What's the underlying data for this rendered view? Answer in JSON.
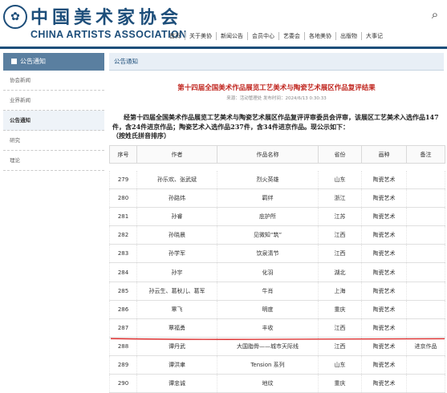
{
  "header": {
    "logo_cn": "中国美术家协会",
    "logo_en": "CHINA ARTISTS ASSOCIATION",
    "nav": [
      "首页",
      "关于美协",
      "新闻公告",
      "会员中心",
      "艺委会",
      "各地美协",
      "出版物",
      "大事记"
    ]
  },
  "sidebar": {
    "title": "公告通知",
    "items": [
      "协会新闻",
      "业界新闻",
      "公告通知",
      "研究",
      "理论"
    ],
    "active_index": 2
  },
  "breadcrumb": "公告通知",
  "article": {
    "title": "第十四届全国美术作品展览工艺美术与陶瓷艺术展区作品复评结果",
    "meta": "来源：活动管理处  发布时间：2024/6/13 0:30:33",
    "paragraph": "经第十四届全国美术作品展览工艺美术与陶瓷艺术展区作品复评评审委员会评审，该展区工艺美术入选作品147件，含24件进京作品；陶瓷艺术入选作品237件，含34件进京作品。现公示如下：",
    "note": "（按姓氏拼音排序）"
  },
  "table": {
    "columns": [
      "序号",
      "作者",
      "作品名称",
      "省份",
      "画种",
      "备注"
    ],
    "rows": [
      [
        "279",
        "孙乐欢、张武斌",
        "烈火英雄",
        "山东",
        "陶瓷艺术",
        ""
      ],
      [
        "280",
        "孙路炜",
        "羁绊",
        "浙江",
        "陶瓷艺术",
        ""
      ],
      [
        "281",
        "孙睿",
        "庇护所",
        "江苏",
        "陶瓷艺术",
        ""
      ],
      [
        "282",
        "孙晓晨",
        "见微知“筑”",
        "江西",
        "陶瓷艺术",
        ""
      ],
      [
        "283",
        "孙学军",
        "饮泉清节",
        "江西",
        "陶瓷艺术",
        ""
      ],
      [
        "284",
        "孙宇",
        "化羽",
        "湖北",
        "陶瓷艺术",
        ""
      ],
      [
        "285",
        "孙云生、葛秋儿、葛军",
        "牛肖",
        "上海",
        "陶瓷艺术",
        ""
      ],
      [
        "286",
        "覃飞",
        "明度",
        "重庆",
        "陶瓷艺术",
        ""
      ],
      [
        "287",
        "覃福勇",
        "丰收",
        "江西",
        "陶瓷艺术",
        ""
      ],
      [
        "288",
        "谭丹武",
        "大国脂骨——城市天际线",
        "江西",
        "陶瓷艺术",
        "进京作品"
      ],
      [
        "289",
        "谭洪聿",
        "Tension    系列",
        "山东",
        "陶瓷艺术",
        ""
      ],
      [
        "290",
        "谭忠诚",
        "地纹",
        "重庆",
        "陶瓷艺术",
        ""
      ]
    ]
  },
  "colors": {
    "brand": "#1d4e7a",
    "title_red": "#c0261f",
    "sidebar_head": "#5a7fa0",
    "annotation_red": "#d81e1e"
  },
  "icons": [
    "search-icon",
    "emblem-icon"
  ]
}
